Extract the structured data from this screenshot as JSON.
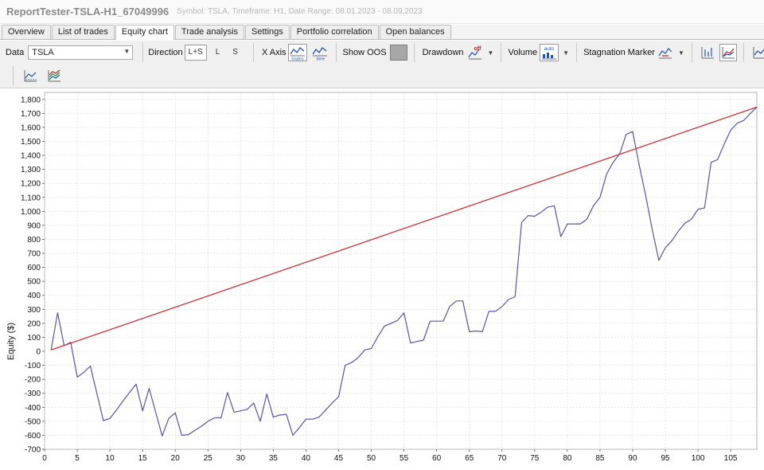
{
  "window": {
    "title": "ReportTester-TSLA-H1_67049996",
    "subtitle": "Symbol: TSLA, Timeframe: H1, Date Range: 08.01.2023 - 08.09.2023"
  },
  "tabs": [
    {
      "label": "Overview",
      "active": false
    },
    {
      "label": "List of trades",
      "active": false
    },
    {
      "label": "Equity chart",
      "active": true
    },
    {
      "label": "Trade analysis",
      "active": false
    },
    {
      "label": "Settings",
      "active": false
    },
    {
      "label": "Portfolio correlation",
      "active": false
    },
    {
      "label": "Open balances",
      "active": false
    }
  ],
  "toolbar": {
    "data_label": "Data",
    "data_value": "TSLA",
    "direction_label": "Direction",
    "direction_options": [
      "L+S",
      "L",
      "S"
    ],
    "direction_selected": "L+S",
    "xaxis_label": "X Axis",
    "xaxis_trades": "trades",
    "xaxis_time": "time",
    "show_oos_label": "Show OOS",
    "drawdown_label": "Drawdown",
    "drawdown_icon_text": "off",
    "volume_label": "Volume",
    "volume_icon_text": "auto",
    "stagnation_label": "Stagnation Marker",
    "colors": {
      "accent_red": "#cc2222",
      "accent_blue": "#2255bb",
      "accent_green": "#229944"
    }
  },
  "chart_data": {
    "type": "line",
    "ylabel": "Equity ($)",
    "xlim": [
      0,
      109
    ],
    "ylim": [
      -700,
      1850
    ],
    "xticks": [
      0,
      5,
      10,
      15,
      20,
      25,
      30,
      35,
      40,
      45,
      50,
      55,
      60,
      65,
      70,
      75,
      80,
      85,
      90,
      95,
      100,
      105
    ],
    "yticks": [
      -700,
      -600,
      -500,
      -400,
      -300,
      -200,
      -100,
      0,
      100,
      200,
      300,
      400,
      500,
      600,
      700,
      800,
      900,
      1000,
      1100,
      1200,
      1300,
      1400,
      1500,
      1600,
      1700,
      1800
    ],
    "grid": true,
    "series": [
      {
        "color": "#5555aa",
        "x": [
          1,
          2,
          3,
          4,
          5,
          6,
          7,
          8,
          9,
          10,
          11,
          12,
          13,
          14,
          15,
          16,
          17,
          18,
          19,
          20,
          21,
          22,
          23,
          24,
          25,
          26,
          27,
          28,
          29,
          30,
          31,
          32,
          33,
          34,
          35,
          36,
          37,
          38,
          39,
          40,
          41,
          42,
          43,
          44,
          45,
          46,
          47,
          48,
          49,
          50,
          51,
          52,
          53,
          54,
          55,
          56,
          57,
          58,
          59,
          60,
          61,
          62,
          63,
          64,
          65,
          66,
          67,
          68,
          69,
          70,
          71,
          72,
          73,
          74,
          75,
          76,
          77,
          78,
          79,
          80,
          81,
          82,
          83,
          84,
          85,
          86,
          87,
          88,
          89,
          90,
          91,
          92,
          93,
          94,
          95,
          96,
          97,
          98,
          99,
          100,
          101,
          102,
          103,
          104,
          105,
          106,
          107,
          108,
          109
        ],
        "y": [
          10,
          275,
          40,
          65,
          -185,
          -150,
          -105,
          -300,
          -495,
          -480,
          -420,
          -355,
          -295,
          -235,
          -425,
          -265,
          -435,
          -605,
          -480,
          -440,
          -600,
          -595,
          -565,
          -535,
          -500,
          -475,
          -475,
          -295,
          -435,
          -425,
          -415,
          -370,
          -500,
          -305,
          -470,
          -455,
          -450,
          -600,
          -545,
          -485,
          -485,
          -470,
          -420,
          -370,
          -325,
          -100,
          -80,
          -45,
          10,
          20,
          105,
          180,
          200,
          220,
          275,
          60,
          70,
          80,
          215,
          215,
          215,
          320,
          360,
          360,
          140,
          145,
          140,
          285,
          285,
          320,
          370,
          390,
          920,
          970,
          965,
          995,
          1030,
          1040,
          820,
          910,
          910,
          910,
          945,
          1040,
          1100,
          1265,
          1350,
          1410,
          1550,
          1570,
          1330,
          1110,
          870,
          650,
          740,
          790,
          860,
          915,
          945,
          1015,
          1025,
          1350,
          1370,
          1480,
          1580,
          1630,
          1650,
          1700,
          1745
        ]
      },
      {
        "color": "#cc3333",
        "x": [
          1,
          109
        ],
        "y": [
          10,
          1745
        ]
      }
    ]
  }
}
